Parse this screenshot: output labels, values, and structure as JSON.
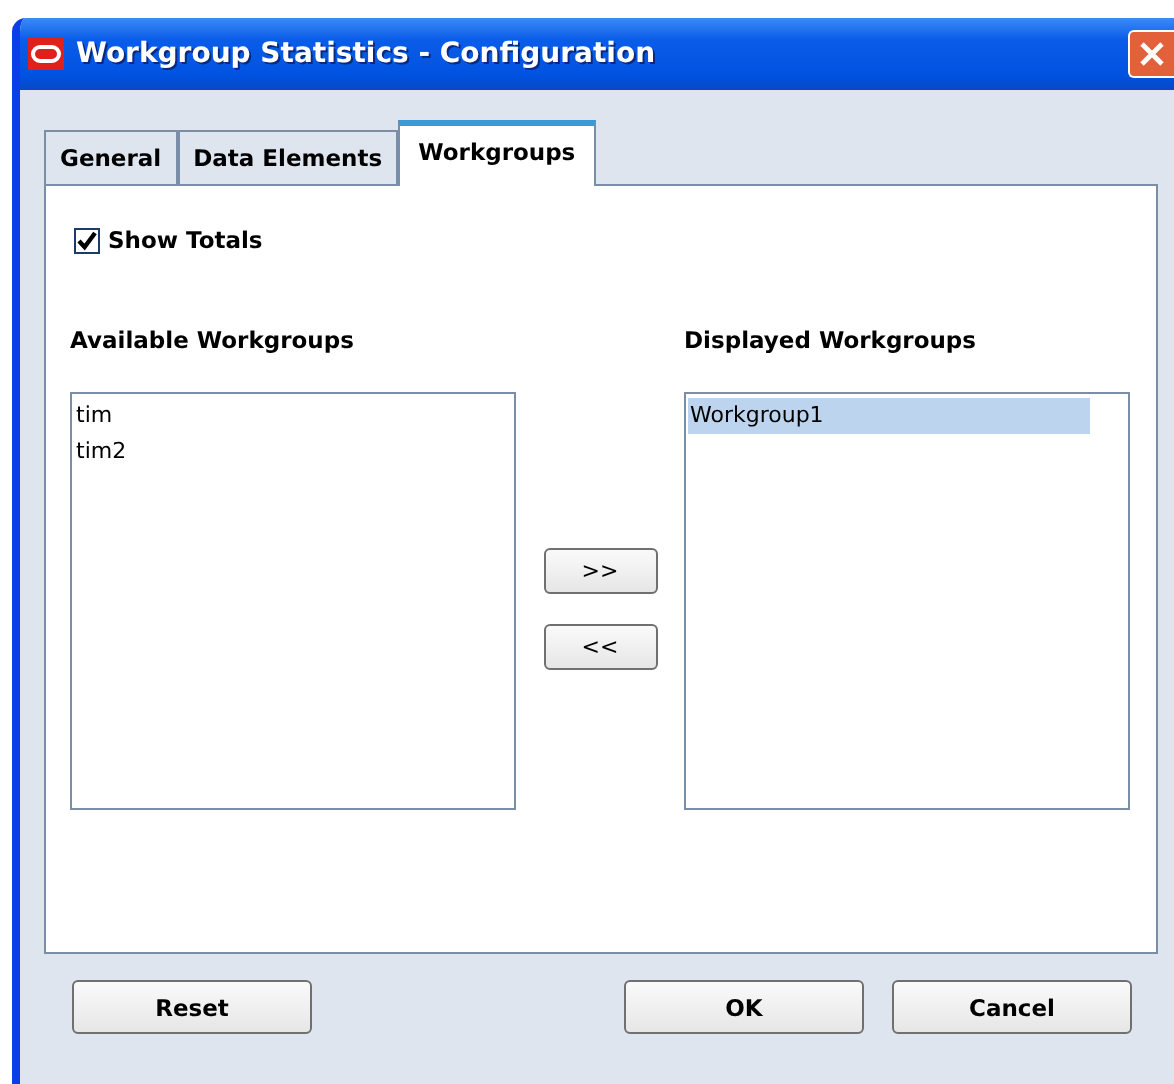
{
  "window": {
    "title": "Workgroup Statistics - Configuration"
  },
  "tabs": [
    {
      "label": "General",
      "selected": false
    },
    {
      "label": "Data Elements",
      "selected": false
    },
    {
      "label": "Workgroups",
      "selected": true
    }
  ],
  "show_totals": {
    "label": "Show Totals",
    "checked": true
  },
  "available": {
    "heading": "Available Workgroups",
    "items": [
      {
        "label": "tim",
        "selected": false
      },
      {
        "label": "tim2",
        "selected": false
      }
    ]
  },
  "move_buttons": [
    ">>",
    "<<"
  ],
  "displayed": {
    "heading": "Displayed Workgroups",
    "items": [
      {
        "label": "Workgroup1",
        "selected": true
      }
    ]
  },
  "buttons": {
    "reset": "Reset",
    "ok": "OK",
    "cancel": "Cancel"
  }
}
